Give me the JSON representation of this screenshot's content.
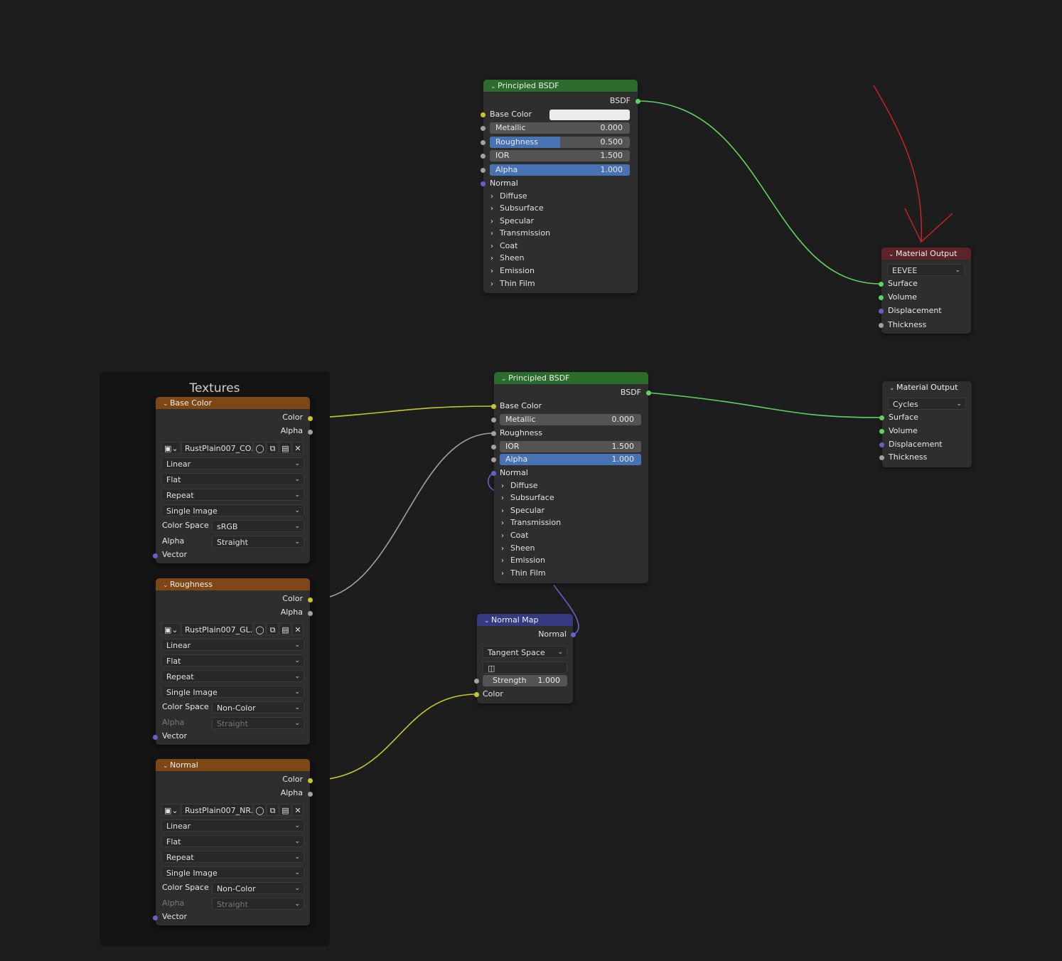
{
  "frame": {
    "title": "Textures"
  },
  "bsdf_top": {
    "title": "Principled BSDF",
    "out": "BSDF",
    "base_color": "Base Color",
    "metallic": {
      "label": "Metallic",
      "value": "0.000"
    },
    "roughness": {
      "label": "Roughness",
      "value": "0.500"
    },
    "ior": {
      "label": "IOR",
      "value": "1.500"
    },
    "alpha": {
      "label": "Alpha",
      "value": "1.000"
    },
    "normal": "Normal",
    "panels": [
      "Diffuse",
      "Subsurface",
      "Specular",
      "Transmission",
      "Coat",
      "Sheen",
      "Emission",
      "Thin Film"
    ]
  },
  "output_top": {
    "title": "Material Output",
    "target": "EEVEE",
    "inputs": [
      "Surface",
      "Volume",
      "Displacement",
      "Thickness"
    ]
  },
  "bsdf_bottom": {
    "title": "Principled BSDF",
    "out": "BSDF",
    "base_color": "Base Color",
    "metallic": {
      "label": "Metallic",
      "value": "0.000"
    },
    "roughness": "Roughness",
    "ior": {
      "label": "IOR",
      "value": "1.500"
    },
    "alpha": {
      "label": "Alpha",
      "value": "1.000"
    },
    "normal": "Normal",
    "panels": [
      "Diffuse",
      "Subsurface",
      "Specular",
      "Transmission",
      "Coat",
      "Sheen",
      "Emission",
      "Thin Film"
    ]
  },
  "output_bottom": {
    "title": "Material Output",
    "target": "Cycles",
    "inputs": [
      "Surface",
      "Volume",
      "Displacement",
      "Thickness"
    ]
  },
  "normal_map": {
    "title": "Normal Map",
    "out": "Normal",
    "space": "Tangent Space",
    "strength": {
      "label": "Strength",
      "value": "1.000"
    },
    "color": "Color"
  },
  "tex_nodes": [
    {
      "title": "Base Color",
      "color": "Color",
      "alpha": "Alpha",
      "image": "RustPlain007_CO...",
      "interpolation": "Linear",
      "projection": "Flat",
      "extension": "Repeat",
      "source": "Single Image",
      "cs_label": "Color Space",
      "color_space": "sRGB",
      "alpha_label": "Alpha",
      "alpha_mode": "Straight",
      "vector": "Vector"
    },
    {
      "title": "Roughness",
      "color": "Color",
      "alpha": "Alpha",
      "image": "RustPlain007_GL...",
      "interpolation": "Linear",
      "projection": "Flat",
      "extension": "Repeat",
      "source": "Single Image",
      "cs_label": "Color Space",
      "color_space": "Non-Color",
      "alpha_label": "Alpha",
      "alpha_mode": "Straight",
      "vector": "Vector"
    },
    {
      "title": "Normal",
      "color": "Color",
      "alpha": "Alpha",
      "image": "RustPlain007_NR...",
      "interpolation": "Linear",
      "projection": "Flat",
      "extension": "Repeat",
      "source": "Single Image",
      "cs_label": "Color Space",
      "color_space": "Non-Color",
      "alpha_label": "Alpha",
      "alpha_mode": "Straight",
      "vector": "Vector"
    }
  ],
  "colors": {
    "link_shader": "#5fd35f",
    "link_color": "#c7c729",
    "link_float": "#a1a1a1",
    "link_vector": "#6363c7",
    "annotation": "#d42323"
  }
}
